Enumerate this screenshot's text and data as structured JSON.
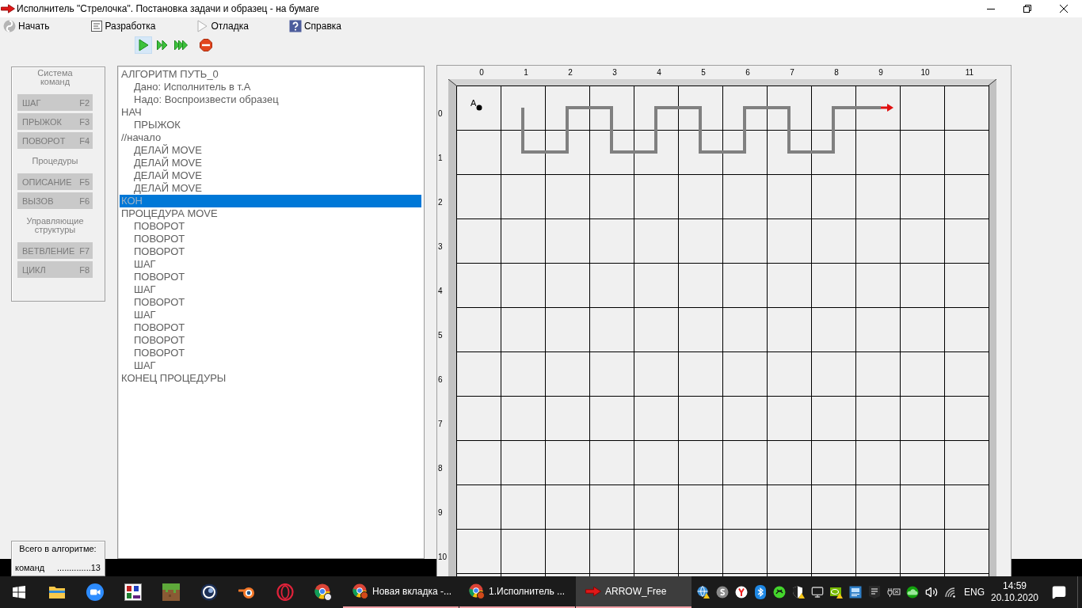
{
  "window": {
    "title": "Исполнитель \"Стрелочка\". Постановка задачи и образец - на бумаге"
  },
  "menu": [
    {
      "kind": "start",
      "label": "Начать"
    },
    {
      "kind": "develop",
      "label": "Разработка"
    },
    {
      "kind": "debug",
      "label": "Отладка"
    },
    {
      "kind": "help",
      "label": "Справка"
    }
  ],
  "toolbar": [
    {
      "kind": "run",
      "pressed": true
    },
    {
      "kind": "step",
      "pressed": false
    },
    {
      "kind": "fast",
      "pressed": false
    },
    {
      "kind": "stop",
      "pressed": false
    }
  ],
  "command_panel": {
    "groups": [
      {
        "title": "Система\nкоманд",
        "buttons": [
          {
            "label": "ШАГ",
            "key": "F2",
            "disabled": true
          },
          {
            "label": "ПРЫЖОК",
            "key": "F3",
            "disabled": true
          },
          {
            "label": "ПОВОРОТ",
            "key": "F4",
            "disabled": true
          }
        ]
      },
      {
        "title": "Процедуры",
        "buttons": [
          {
            "label": "ОПИСАНИЕ",
            "key": "F5",
            "disabled": true
          },
          {
            "label": "ВЫЗОВ",
            "key": "F6",
            "disabled": true
          }
        ]
      },
      {
        "title": "Управляющие\nструктуры",
        "buttons": [
          {
            "label": "ВЕТВЛЕНИЕ",
            "key": "F7",
            "disabled": true
          },
          {
            "label": "ЦИКЛ",
            "key": "F8",
            "disabled": true
          }
        ]
      }
    ]
  },
  "summary": {
    "title": "Всего в алгоритме:",
    "label": "команд",
    "value": "..............13"
  },
  "program": {
    "lines": [
      {
        "text": "АЛГОРИТМ ПУТЬ_0",
        "selected": false,
        "children": [
          {
            "text": "Дано: Исполнитель в т.А",
            "selected": false
          },
          {
            "text": "Надо: Воспроизвести образец",
            "selected": false
          }
        ]
      },
      {
        "text": "НАЧ",
        "selected": false,
        "children": [
          {
            "text": "ПРЫЖОК",
            "selected": false
          }
        ]
      },
      {
        "text": "//начало",
        "selected": false,
        "children": [
          {
            "text": "ДЕЛАЙ MOVE",
            "selected": false
          },
          {
            "text": "ДЕЛАЙ MOVE",
            "selected": false
          },
          {
            "text": "ДЕЛАЙ MOVE",
            "selected": false
          },
          {
            "text": "ДЕЛАЙ MOVE",
            "selected": false
          }
        ]
      },
      {
        "text": "КОН",
        "selected": true
      },
      {
        "text": "ПРОЦЕДУРА MOVE",
        "selected": false,
        "children": [
          {
            "text": "ПОВОРОТ",
            "selected": false
          },
          {
            "text": "ПОВОРОТ",
            "selected": false
          },
          {
            "text": "ПОВОРОТ",
            "selected": false
          },
          {
            "text": "ШАГ",
            "selected": false
          },
          {
            "text": "ПОВОРОТ",
            "selected": false
          },
          {
            "text": "ШАГ",
            "selected": false
          },
          {
            "text": "ПОВОРОТ",
            "selected": false
          },
          {
            "text": "ШАГ",
            "selected": false
          },
          {
            "text": "ПОВОРОТ",
            "selected": false
          },
          {
            "text": "ПОВОРОТ",
            "selected": false
          },
          {
            "text": "ПОВОРОТ",
            "selected": false
          },
          {
            "text": "ШАГ",
            "selected": false
          }
        ]
      },
      {
        "text": "КОНЕЦ ПРОЦЕДУРЫ",
        "selected": false
      }
    ]
  },
  "field": {
    "columns": [
      "0",
      "1",
      "2",
      "3",
      "4",
      "5",
      "6",
      "7",
      "8",
      "9",
      "10",
      "11"
    ],
    "rows": [
      "0",
      "1",
      "2",
      "3",
      "4",
      "5",
      "6",
      "7",
      "8",
      "9",
      "10"
    ],
    "start_label": "A"
  },
  "taskbar": {
    "tasks": [
      {
        "kind": "browser",
        "label": "Новая вкладка -...",
        "active": false
      },
      {
        "kind": "browser",
        "label": "1.Исполнитель ...",
        "active": false
      },
      {
        "kind": "arrow",
        "label": "ARROW_Free",
        "active": true
      }
    ],
    "language": "ENG",
    "time": "14:59",
    "date": "20.10.2020"
  }
}
